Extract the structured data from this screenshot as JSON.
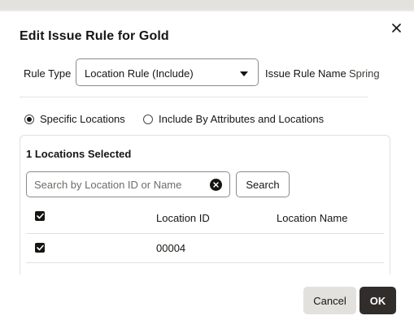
{
  "dialog": {
    "title": "Edit Issue Rule for Gold",
    "close_icon": "close-icon"
  },
  "rule": {
    "type_label": "Rule Type",
    "type_value": "Location Rule (Include)",
    "name_label": "Issue Rule Name",
    "name_value": "Spring"
  },
  "mode": {
    "options": [
      {
        "label": "Specific Locations",
        "selected": true
      },
      {
        "label": "Include By Attributes and Locations",
        "selected": false
      }
    ]
  },
  "locations": {
    "selected_count_text": "1 Locations Selected",
    "search_placeholder": "Search by Location ID or Name",
    "search_value": "",
    "search_button": "Search",
    "columns": [
      "Location ID",
      "Location Name"
    ],
    "header_checked": true,
    "rows": [
      {
        "checked": true,
        "id": "00004",
        "name": ""
      }
    ]
  },
  "footer": {
    "cancel_label": "Cancel",
    "ok_label": "OK"
  },
  "colors": {
    "primary_button": "#312d2a",
    "secondary_button": "#e3e1de",
    "text": "#161513"
  }
}
